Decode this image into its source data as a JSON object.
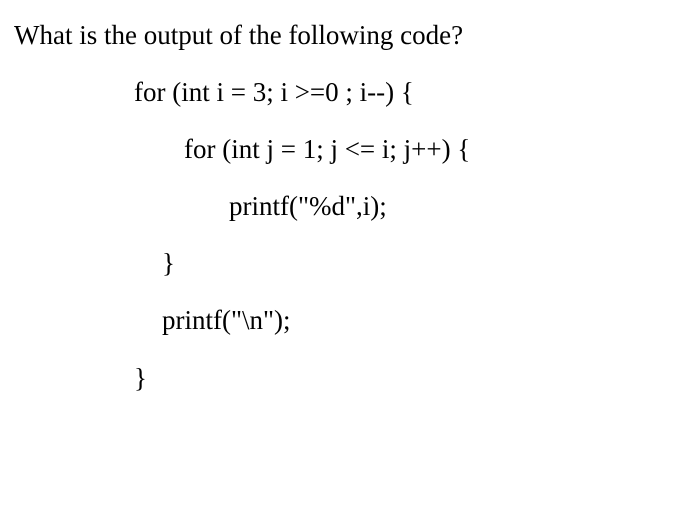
{
  "question": "What is the output of the following code?",
  "code": {
    "line1": "for (int i = 3; i >=0 ; i--) {",
    "line2": "for (int j = 1; j <= i; j++) {",
    "line3": "printf(\"%d\",i);",
    "line4": "}",
    "line5": "printf(\"\\n\");",
    "line6": "}"
  }
}
